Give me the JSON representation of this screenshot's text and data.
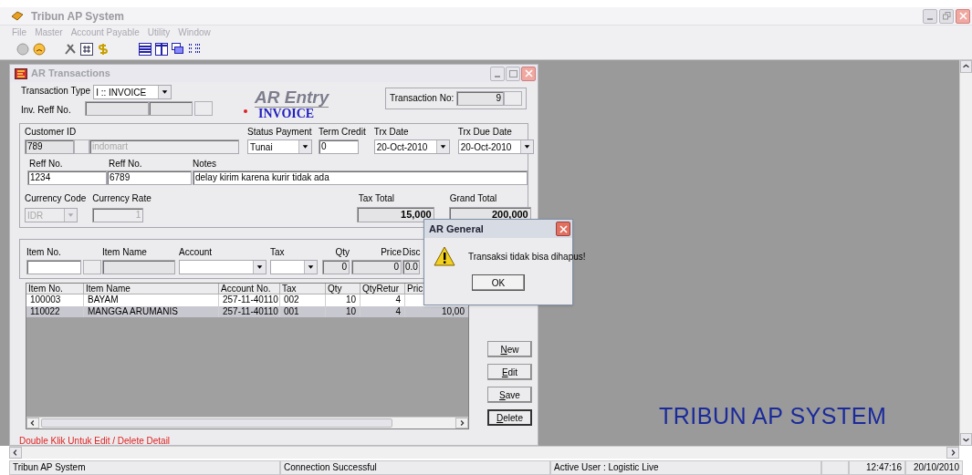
{
  "window": {
    "title": "Tribun AP System"
  },
  "menu": [
    {
      "label": "File",
      "disabled": true
    },
    {
      "label": "Master",
      "disabled": true
    },
    {
      "label": "Account Payable",
      "disabled": true
    },
    {
      "label": "Utility",
      "disabled": true
    },
    {
      "label": "Window",
      "disabled": true
    }
  ],
  "child_window": {
    "title": "AR Transactions",
    "transaction_type": {
      "label": "Transaction Type",
      "value": "I :: INVOICE"
    },
    "inv_reff_no": {
      "label": "Inv. Reff No."
    },
    "logo": {
      "title": "AR Entry",
      "subtitle": "INVOICE"
    },
    "transaction_no": {
      "label": "Transaction No:",
      "value": "9"
    },
    "customer": {
      "label": "Customer ID",
      "id": "789",
      "name": "indomart"
    },
    "status_payment": {
      "label": "Status Payment",
      "value": "Tunai"
    },
    "term_credit": {
      "label": "Term Credit",
      "value": "0"
    },
    "trx_date": {
      "label": "Trx Date",
      "value": "20-Oct-2010"
    },
    "trx_due_date": {
      "label": "Trx Due Date",
      "value": "20-Oct-2010"
    },
    "reff_no_1": {
      "label": "Reff No.",
      "value": "1234"
    },
    "reff_no_2": {
      "label": "Reff No.",
      "value": "6789"
    },
    "notes": {
      "label": "Notes",
      "value": "delay kirim karena kurir tidak ada"
    },
    "currency_code": {
      "label": "Currency Code",
      "value": "IDR",
      "disabled": true
    },
    "currency_rate": {
      "label": "Currency Rate",
      "value": "1",
      "disabled": true
    },
    "tax_total": {
      "label": "Tax Total",
      "value": "15,000"
    },
    "grand_total": {
      "label": "Grand Total",
      "value": "200,000"
    },
    "item_entry": [
      {
        "kind": "lookup",
        "label": "Item No."
      },
      {
        "kind": "text",
        "label": "Item Name"
      },
      {
        "kind": "combo",
        "label": "Account"
      },
      {
        "kind": "combo",
        "label": "Tax"
      },
      {
        "kind": "number",
        "label": "Qty",
        "value": "0"
      },
      {
        "kind": "number",
        "label": "Price",
        "value": "0"
      },
      {
        "kind": "number",
        "label": "Disc",
        "value": "0.0"
      }
    ],
    "details": {
      "columns": [
        "Item No.",
        "Item Name",
        "Account No.",
        "Tax",
        "Qty",
        "QtyRetur",
        "Pric"
      ],
      "rows": [
        {
          "selected": false,
          "cells": [
            "100003",
            "BAYAM",
            "257-11-40110",
            "002",
            "10",
            "4"
          ]
        },
        {
          "selected": true,
          "cells": [
            "110022",
            "MANGGA ARUMANIS",
            "257-11-40110",
            "001",
            "10",
            "4",
            "10,00"
          ]
        }
      ]
    },
    "buttons": [
      {
        "label": "New",
        "focused": false
      },
      {
        "label": "Edit",
        "focused": false
      },
      {
        "label": "Save",
        "focused": false
      },
      {
        "label": "Delete",
        "focused": true
      }
    ],
    "hint": "Double Klik Untuk Edit / Delete Detail"
  },
  "background_text": "TRIBUN AP SYSTEM",
  "dialog": {
    "title": "AR General",
    "message": "Transaksi tidak bisa dihapus!",
    "button": "OK"
  },
  "status_bar": [
    "Tribun AP System",
    "Connection Successful",
    "Active User : Logistic Live",
    "12:47:16",
    "20/10/2010"
  ]
}
